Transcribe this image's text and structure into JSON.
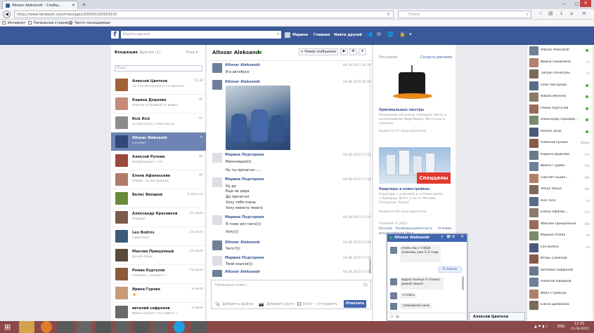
{
  "browser": {
    "tab_title": "Altosar Aleksandr - Сообщ...",
    "url": "https://www.facebook.com/messages/100001100259102",
    "search_placeholder": "Поиск",
    "bookmarks": [
      "Интернет",
      "Начальная страница",
      "Часто посещаемые"
    ]
  },
  "header": {
    "search_placeholder": "Ищите друзей",
    "profile": "Марина",
    "home": "Главная",
    "find_friends": "Найти друзей"
  },
  "left": {
    "tab_inbox": "Входящие",
    "tab_other": "Другие (1)",
    "more": "Еще ▾",
    "search_placeholder": "Поиск",
    "conversations": [
      {
        "name": "Алексей Цветков",
        "preview": "Ты что ли переехал со своей ма...",
        "time": "12:30"
      },
      {
        "name": "Карина Доднова",
        "preview": "Карина отправил(-а) видео",
        "time": "Вт"
      },
      {
        "name": "Rick Rick",
        "preview": "интересная у тебя жизнь",
        "time": "Пт"
      },
      {
        "name": "Altosar Aleksandr",
        "preview": "Почему?",
        "time": "Чт"
      },
      {
        "name": "Алексей Ручкин",
        "preview": "Возвращаюсь 7-го",
        "time": "Вт"
      },
      {
        "name": "Елена Афанасьева",
        "preview": "Нафиг. Ты же будешь",
        "time": "Вт"
      },
      {
        "name": "Велес Вихарев",
        "preview": "",
        "time": "4 августа"
      },
      {
        "name": "Александр Красников",
        "preview": "Хорошо",
        "time": "31 июля"
      },
      {
        "name": "Leo Bodrov",
        "preview": "Приветик)",
        "time": "24 июля"
      },
      {
        "name": "Максим Прищепный",
        "preview": "Доной порш",
        "time": "23 июля"
      },
      {
        "name": "Роман Куртузов",
        "preview": "Романик, спасибо!!!!",
        "time": "23 июля"
      },
      {
        "name": "Ирина Гурова",
        "preview": "👍",
        "time": "9 июля"
      },
      {
        "name": "виталий сафронов",
        "preview": "Ирина привет что нового ?",
        "time": "3 июля"
      }
    ]
  },
  "thread": {
    "title": "Altosar Aleksandr",
    "new_message": "+ Новое сообщение",
    "messages": [
      {
        "author": "Altosar Aleksandr",
        "time": "04.08.2015 16:59",
        "lines": [
          "Я в автобусе"
        ]
      },
      {
        "author": "Altosar Aleksandr",
        "time": "04.08.2015 16:59",
        "lines": []
      },
      {
        "author": "Марина Подгорная",
        "time": "04.08.2015 17:03",
        "lines": [
          "Мальчишки)))",
          "",
          "Ну ты прочитал ....."
        ]
      },
      {
        "author": "Марина Подгорная",
        "time": "04.08.2015 17:04",
        "lines": [
          "Ну да",
          "Еще не дядя",
          "Да прочитал",
          "Хочу тебя очень",
          "Хочу минета твоего"
        ]
      },
      {
        "author": "Марина Подгорная",
        "time": "04.08.2015 17:04",
        "lines": [
          "Я тоже хоч-чаго))))",
          "",
          "Хочу)))"
        ]
      },
      {
        "author": "Altosar Aleksandr",
        "time": "04.08.2015 17:04",
        "lines": [
          "Чего?)))"
        ]
      },
      {
        "author": "Марина Подгорная",
        "time": "04.08.2015 17:05",
        "lines": [
          "Твой язычок)))"
        ]
      },
      {
        "author": "Altosar Aleksandr",
        "time": "04.08.2015 17:05",
        "lines": [
          "Почему?"
        ]
      }
    ],
    "composer_placeholder": "Напишите ответ...",
    "add_files": "Добавить файлы",
    "add_photo": "Добавить фото",
    "enter_hint": "Enter — отправить",
    "send": "Ответить"
  },
  "ads": {
    "title": "Реклама",
    "create": "Создать рекламу",
    "ad1": {
      "title": "Оригинальные люстры",
      "text": "Роскошные магазины немецких люстр в эксклюзивном Regenbogen. Все очень в наличии.",
      "likes": "Нравится 27 пользователям"
    },
    "ad2": {
      "banner": "Спеццены",
      "title": "Квартиры в новостройках",
      "text": "Квартиры с отделкой в готовом доме! г.Люберцы. Всего 3 км от Москвы. Спеццены! Звони!",
      "likes": "Нравится 40 пользователям"
    },
    "footer": [
      "Facebook © 2015",
      "Русский",
      "Конфиденциальность",
      "Условия",
      "использования",
      "Рекл..."
    ]
  },
  "chat_popup": {
    "name": "Altosar Aleksandr",
    "messages": [
      {
        "side": "left",
        "text": "очень мы с тобой знакомы уже 2-3 года"
      },
      {
        "side": "right",
        "text": "Я помню"
      },
      {
        "side": "left",
        "text": "видно солнце я только домой зашел"
      },
      {
        "side": "left",
        "text": "я спать"
      },
      {
        "side": "left",
        "text": "спокойной ночи"
      }
    ]
  },
  "friends": [
    {
      "name": "Altosar Aleksandr",
      "status": "online"
    },
    {
      "name": "Ирина Пашинина",
      "status": "1ч"
    },
    {
      "name": "Тигран Хачатрян",
      "status": "5ч"
    },
    {
      "name": "Олег Нагорнов",
      "status": "online"
    },
    {
      "name": "Nikolai Belevski",
      "status": "online"
    },
    {
      "name": "Роман Куртузов",
      "status": "online"
    },
    {
      "name": "Александр Просвир...",
      "status": "online"
    },
    {
      "name": "Roman Zhuk",
      "status": "online"
    },
    {
      "name": "Алексей Ручкин",
      "status": "58мин"
    },
    {
      "name": "Карина Доднова",
      "status": "21ч"
    },
    {
      "name": "Ирина Гурова",
      "status": "18ч"
    },
    {
      "name": "Сергей Сошин...",
      "status": "28ч"
    },
    {
      "name": "Vanya Vanya",
      "status": "28ч"
    },
    {
      "name": "Rick Rick",
      "status": "6ч"
    },
    {
      "name": "Елена Афанас...",
      "status": "15ч"
    },
    {
      "name": "Максим Прищепный",
      "status": "49ч"
    },
    {
      "name": "Марина Атила",
      "status": "8ч"
    },
    {
      "name": "Leo Bodrov",
      "status": "6ч"
    },
    {
      "name": "Игорь Семенов",
      "status": ""
    },
    {
      "name": "виталий сафронов",
      "status": ""
    },
    {
      "name": "Алексей Адмиров",
      "status": ""
    },
    {
      "name": "Иван Стребуль",
      "status": ""
    },
    {
      "name": "Елена Диевнина",
      "status": ""
    }
  ],
  "bottom_chat_tab": "Алексей Цветков",
  "taskbar": {
    "lang": "ENG",
    "time": "12:31",
    "date": "11.08.2015"
  }
}
